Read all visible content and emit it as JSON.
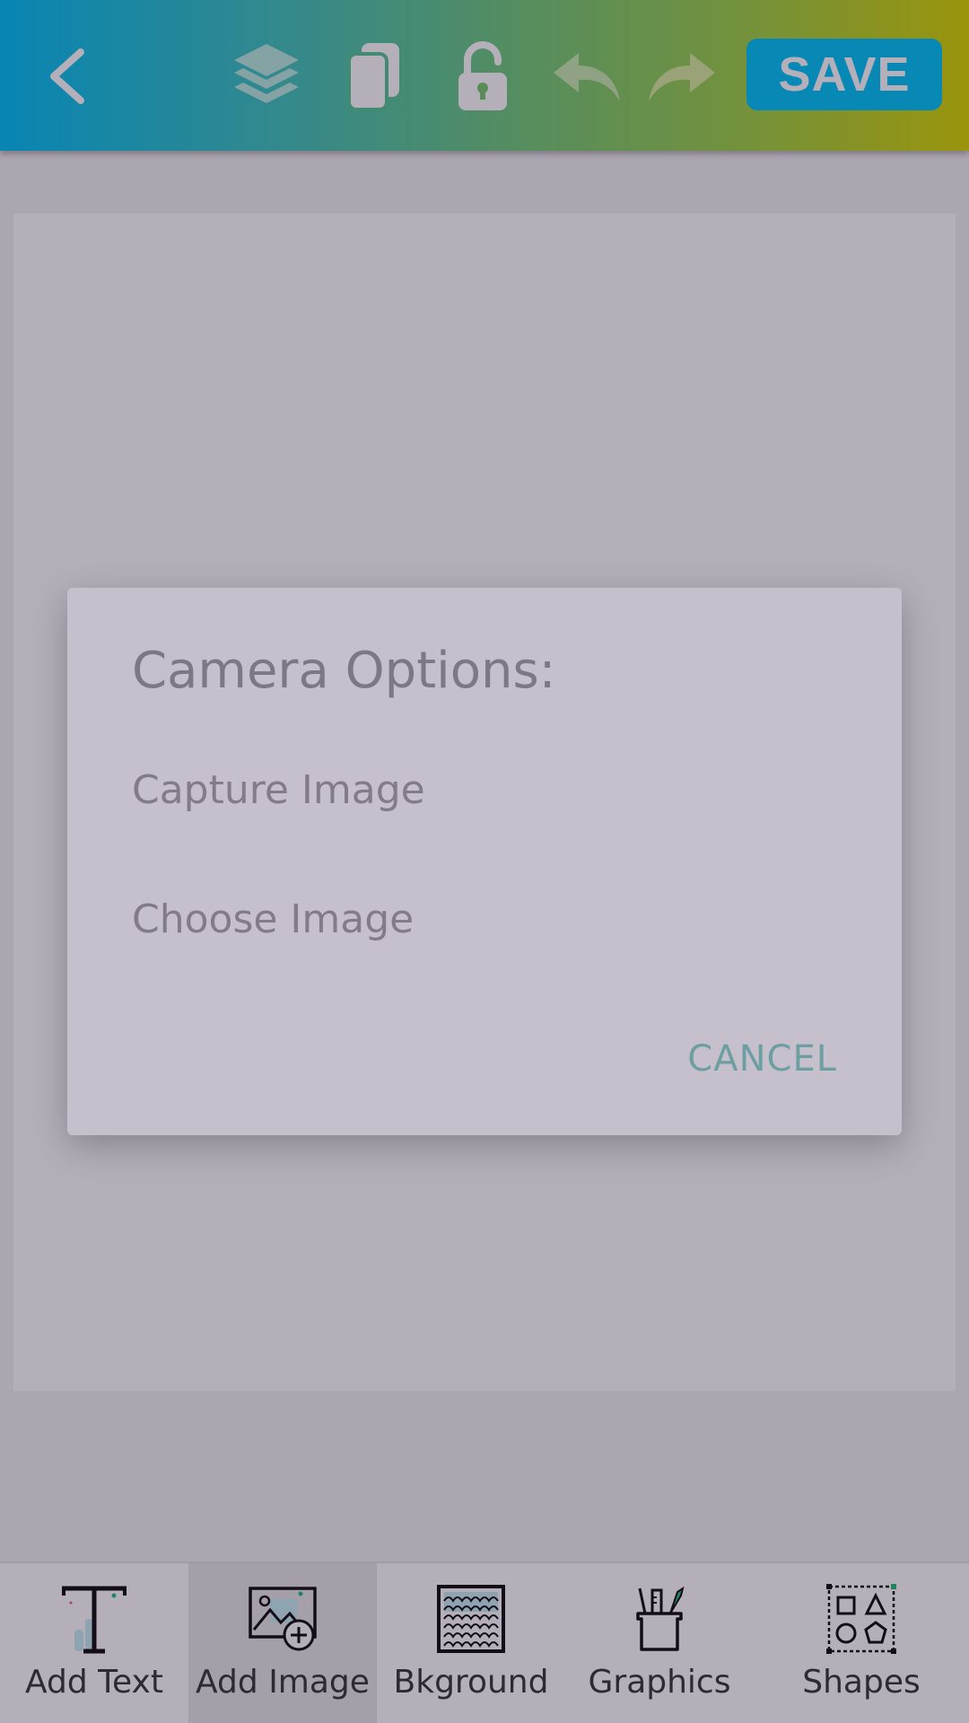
{
  "toolbar": {
    "save_label": "SAVE",
    "icons": [
      "chevron-left-icon",
      "layers-icon",
      "copy-icon",
      "unlock-icon",
      "undo-icon",
      "redo-icon"
    ]
  },
  "dialog": {
    "title": "Camera Options:",
    "options": [
      {
        "label": "Capture Image"
      },
      {
        "label": "Choose Image"
      }
    ],
    "cancel_label": "CANCEL"
  },
  "bottom_bar": {
    "items": [
      {
        "label": "Add Text",
        "icon": "text-icon",
        "selected": false
      },
      {
        "label": "Add Image",
        "icon": "add-image-icon",
        "selected": true
      },
      {
        "label": "Bkground",
        "icon": "background-pattern-icon",
        "selected": false
      },
      {
        "label": "Graphics",
        "icon": "graphics-brush-icon",
        "selected": false
      },
      {
        "label": "Shapes",
        "icon": "shapes-icon",
        "selected": false
      }
    ]
  },
  "colors": {
    "save_button": "#00c6f8",
    "dialog_bg": "#c6c0cc",
    "cancel_text": "#6d9ea1",
    "gradient_start": "#00c2f6",
    "gradient_end": "#d7d800"
  }
}
